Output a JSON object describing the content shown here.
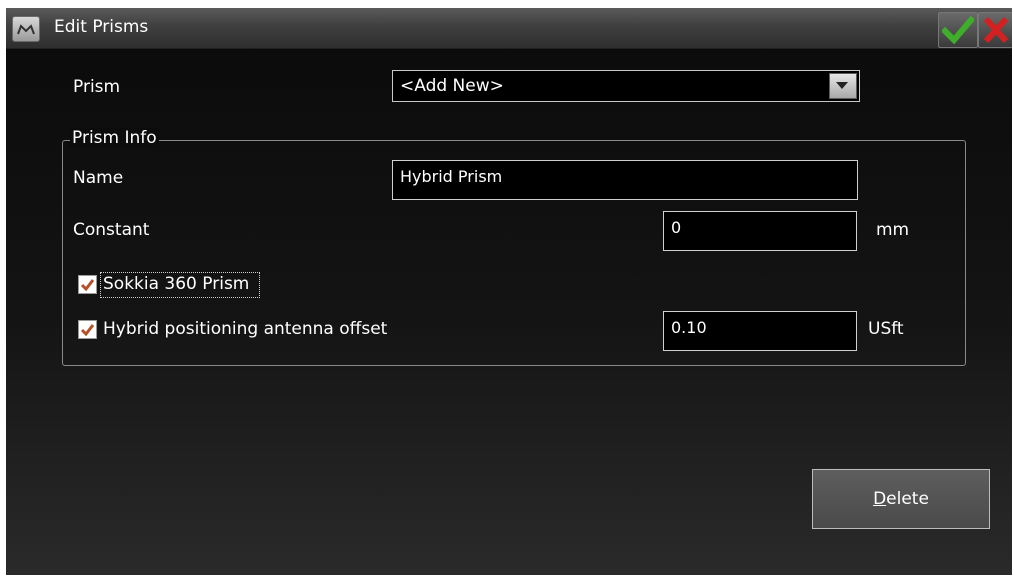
{
  "window": {
    "title": "Edit Prisms",
    "app_icon": "app-logo-icon",
    "ok_icon": "check-icon",
    "cancel_icon": "close-icon"
  },
  "prism": {
    "label": "Prism",
    "selected": "<Add New>"
  },
  "prism_info": {
    "legend": "Prism Info",
    "name_label": "Name",
    "name_value": "Hybrid Prism",
    "constant_label": "Constant",
    "constant_value": "0",
    "constant_unit": "mm",
    "sokkia_checked": true,
    "sokkia_label": "Sokkia 360 Prism",
    "hybrid_checked": true,
    "hybrid_label": "Hybrid positioning antenna offset",
    "hybrid_value": "0.10",
    "hybrid_unit": "USft"
  },
  "actions": {
    "delete_first": "D",
    "delete_rest": "elete"
  },
  "colors": {
    "check_green": "#3fae2a",
    "close_red": "#d32020",
    "checkbox_mark": "#b5502a"
  }
}
